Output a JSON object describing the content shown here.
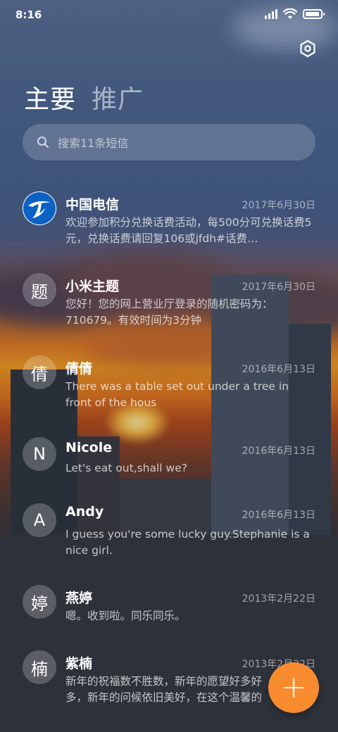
{
  "status_bar": {
    "time": "8:16"
  },
  "header": {
    "tabs": [
      {
        "label": "主要",
        "active": true
      },
      {
        "label": "推广",
        "active": false
      }
    ],
    "settings_icon": "gear-icon"
  },
  "search": {
    "placeholder": "搜索11条短信"
  },
  "conversations": [
    {
      "avatar": "",
      "avatar_icon": "china-telecom-logo",
      "name": "中国电信",
      "date": "2017年6月30日",
      "preview": "欢迎参加积分兑换话费活动，每500分可兑换话费5元，兑换话费请回复106或jfdh#话费…"
    },
    {
      "avatar": "题",
      "name": "小米主题",
      "date": "2017年6月30日",
      "preview": "您好！您的网上营业厅登录的随机密码为：710679。有效时间为3分钟"
    },
    {
      "avatar": "倩",
      "name": "倩倩",
      "date": "2016年6月13日",
      "preview": "There was a table set out under a tree in front of the hous"
    },
    {
      "avatar": "N",
      "name": "Nicole",
      "date": "2016年6月13日",
      "preview": "Let's eat out,shall we?"
    },
    {
      "avatar": "A",
      "name": "Andy",
      "date": "2016年6月13日",
      "preview": "I guess you're some lucky guy.Stephanie is a nice girl."
    },
    {
      "avatar": "婷",
      "name": "燕婷",
      "date": "2013年2月22日",
      "preview": "嗯。收到啦。同乐同乐。"
    },
    {
      "avatar": "楠",
      "name": "紫楠",
      "date": "2013年2月22日",
      "preview": "新年的祝福数不胜数，新年的愿望好多好多，新年的问候依旧美好，在这个温馨的时刻"
    }
  ],
  "fab": {
    "label": "+",
    "color": "#f78b2e"
  }
}
